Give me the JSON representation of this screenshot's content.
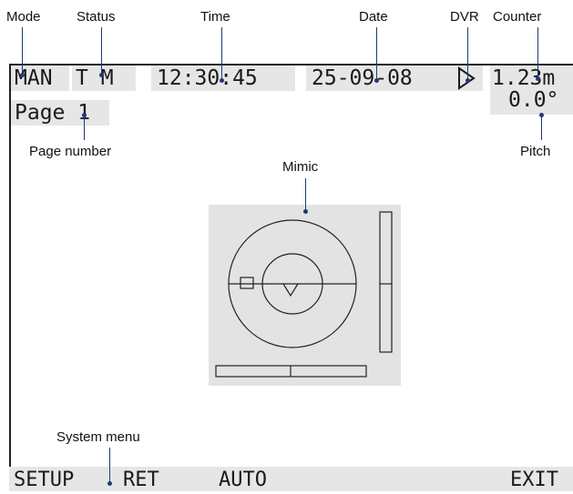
{
  "callouts": {
    "mode": "Mode",
    "status": "Status",
    "time": "Time",
    "date": "Date",
    "dvr": "DVR",
    "counter": "Counter",
    "page_number": "Page number",
    "pitch": "Pitch",
    "mimic": "Mimic",
    "system_menu": "System menu"
  },
  "screen": {
    "mode": "MAN",
    "status": "T M",
    "time": "12:30:45",
    "date": "25-09-08",
    "dvr_icon": "play-triangle-icon",
    "counter": "1.23m",
    "pitch": "0.0°",
    "page": "Page 1"
  },
  "menu": {
    "setup": "SETUP",
    "ret": "RET",
    "auto": "AUTO",
    "exit": "EXIT"
  },
  "colors": {
    "field_bg": "#e6e6e6",
    "mimic_bg": "#e3e3e3",
    "leader": "#1f3a7a",
    "screen_border": "#222222"
  }
}
